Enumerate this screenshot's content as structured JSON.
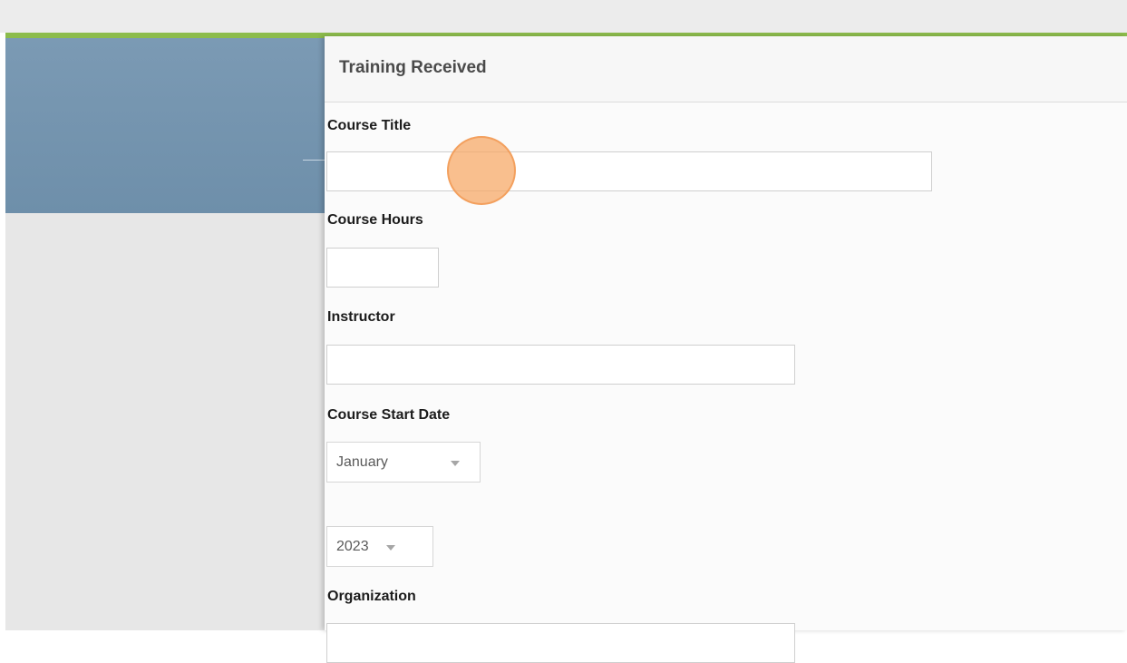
{
  "dialog": {
    "title": "Training Received"
  },
  "form": {
    "course_title": {
      "label": "Course Title",
      "value": ""
    },
    "course_hours": {
      "label": "Course Hours",
      "value": ""
    },
    "instructor": {
      "label": "Instructor",
      "value": ""
    },
    "course_start_date": {
      "label": "Course Start Date",
      "month": "January",
      "year": "2023"
    },
    "organization": {
      "label": "Organization",
      "value": ""
    }
  },
  "colors": {
    "accent_green": "#8cbc4c",
    "sidebar_blue": "#7395b0",
    "click_highlight": "#f7a662"
  }
}
